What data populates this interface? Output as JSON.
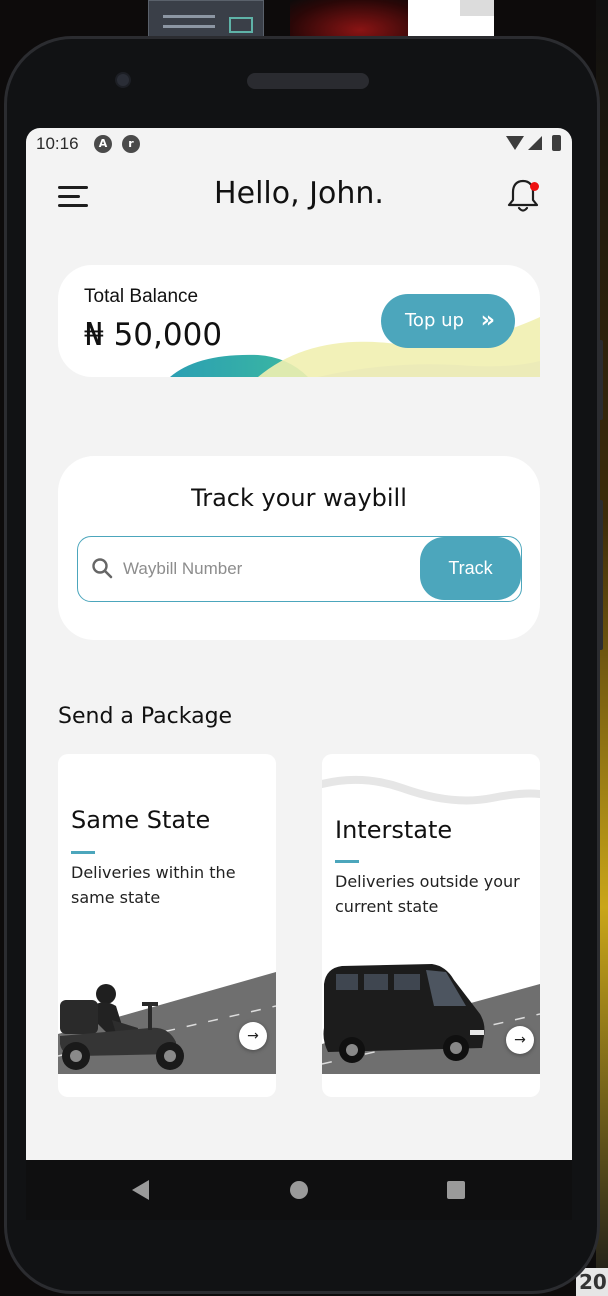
{
  "status_bar": {
    "time": "10:16",
    "icons": [
      "android-auto-icon",
      "app-notification-icon",
      "wifi-icon",
      "signal-icon",
      "battery-icon"
    ],
    "badge_a": "A",
    "badge_r": "r"
  },
  "header": {
    "greeting": "Hello, John.",
    "menu_icon": "menu-icon",
    "notification_icon": "bell-icon",
    "notification_dot_color": "#ee1111"
  },
  "balance": {
    "label": "Total Balance",
    "amount": "₦ 50,000",
    "topup_label": "Top up",
    "topup_icon": "double-chevron-right-icon"
  },
  "track": {
    "title": "Track your waybill",
    "input_value": "",
    "input_placeholder": "Waybill Number",
    "button_label": "Track"
  },
  "send_package": {
    "title": "Send a Package",
    "cards": [
      {
        "title": "Same State",
        "description": "Deliveries within the same state",
        "illustration": "scooter-rider-icon",
        "action_icon": "arrow-right-icon"
      },
      {
        "title": "Interstate",
        "description": "Deliveries outside your current state",
        "illustration": "van-icon",
        "action_icon": "arrow-right-icon"
      }
    ]
  },
  "nav_bar": {
    "icons": [
      "back-icon",
      "home-icon",
      "recents-icon"
    ]
  },
  "colors": {
    "accent": "#4ca6bc",
    "screen_background": "#f3f3f3",
    "card_background": "#ffffff",
    "text": "#111111"
  },
  "desktop_edge_text": "20"
}
